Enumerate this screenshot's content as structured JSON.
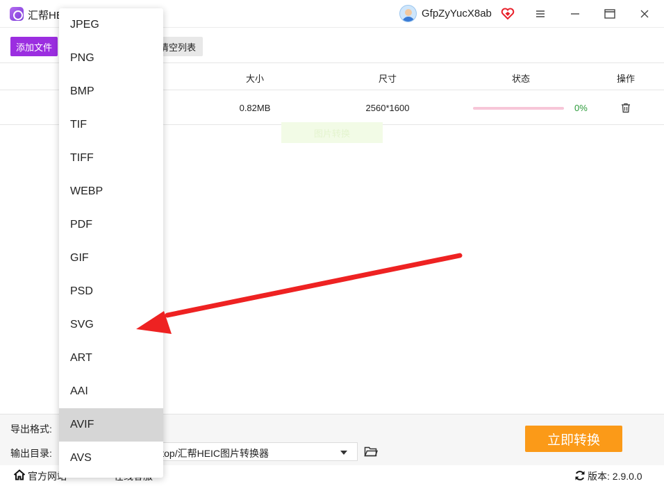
{
  "window": {
    "app_title": "汇帮HEIC图片转换器",
    "username": "GfpZyYucX8ab",
    "icons": [
      "app-logo-icon",
      "vip-heart-icon",
      "menu-icon",
      "minimize-icon",
      "maximize-icon",
      "close-icon"
    ]
  },
  "toolbar": {
    "add_label": "添加文件",
    "clear_label": "清空列表"
  },
  "table": {
    "headers": [
      "大小",
      "尺寸",
      "状态",
      "操作"
    ],
    "rows": [
      {
        "size": "0.82MB",
        "dimensions": "2560*1600",
        "progress": 0,
        "progress_text": "0%"
      }
    ]
  },
  "ghost_text": "图片转换",
  "bottom": {
    "format_label": "导出格式:",
    "dir_label": "输出目录:",
    "dir_value": "C:/Users/Desktop/汇帮HEIC图片转换器",
    "convert_label": "立即转换"
  },
  "statusbar": {
    "website_label": "官方网站",
    "online_label": "在线客服",
    "version_label": "版本:",
    "version_value": "2.9.0.0"
  },
  "format_dropdown": {
    "options": [
      "JPEG",
      "PNG",
      "BMP",
      "TIF",
      "TIFF",
      "WEBP",
      "PDF",
      "GIF",
      "PSD",
      "SVG",
      "ART",
      "AAI",
      "AVIF",
      "AVS"
    ],
    "highlighted": "AVIF"
  },
  "colors": {
    "accent_purple": "#9b2ee0",
    "convert_orange": "#fb9a18",
    "progress_pink": "#e0559a",
    "progress_text_green": "#2c9b3a",
    "annotation_red": "#ee2222"
  }
}
